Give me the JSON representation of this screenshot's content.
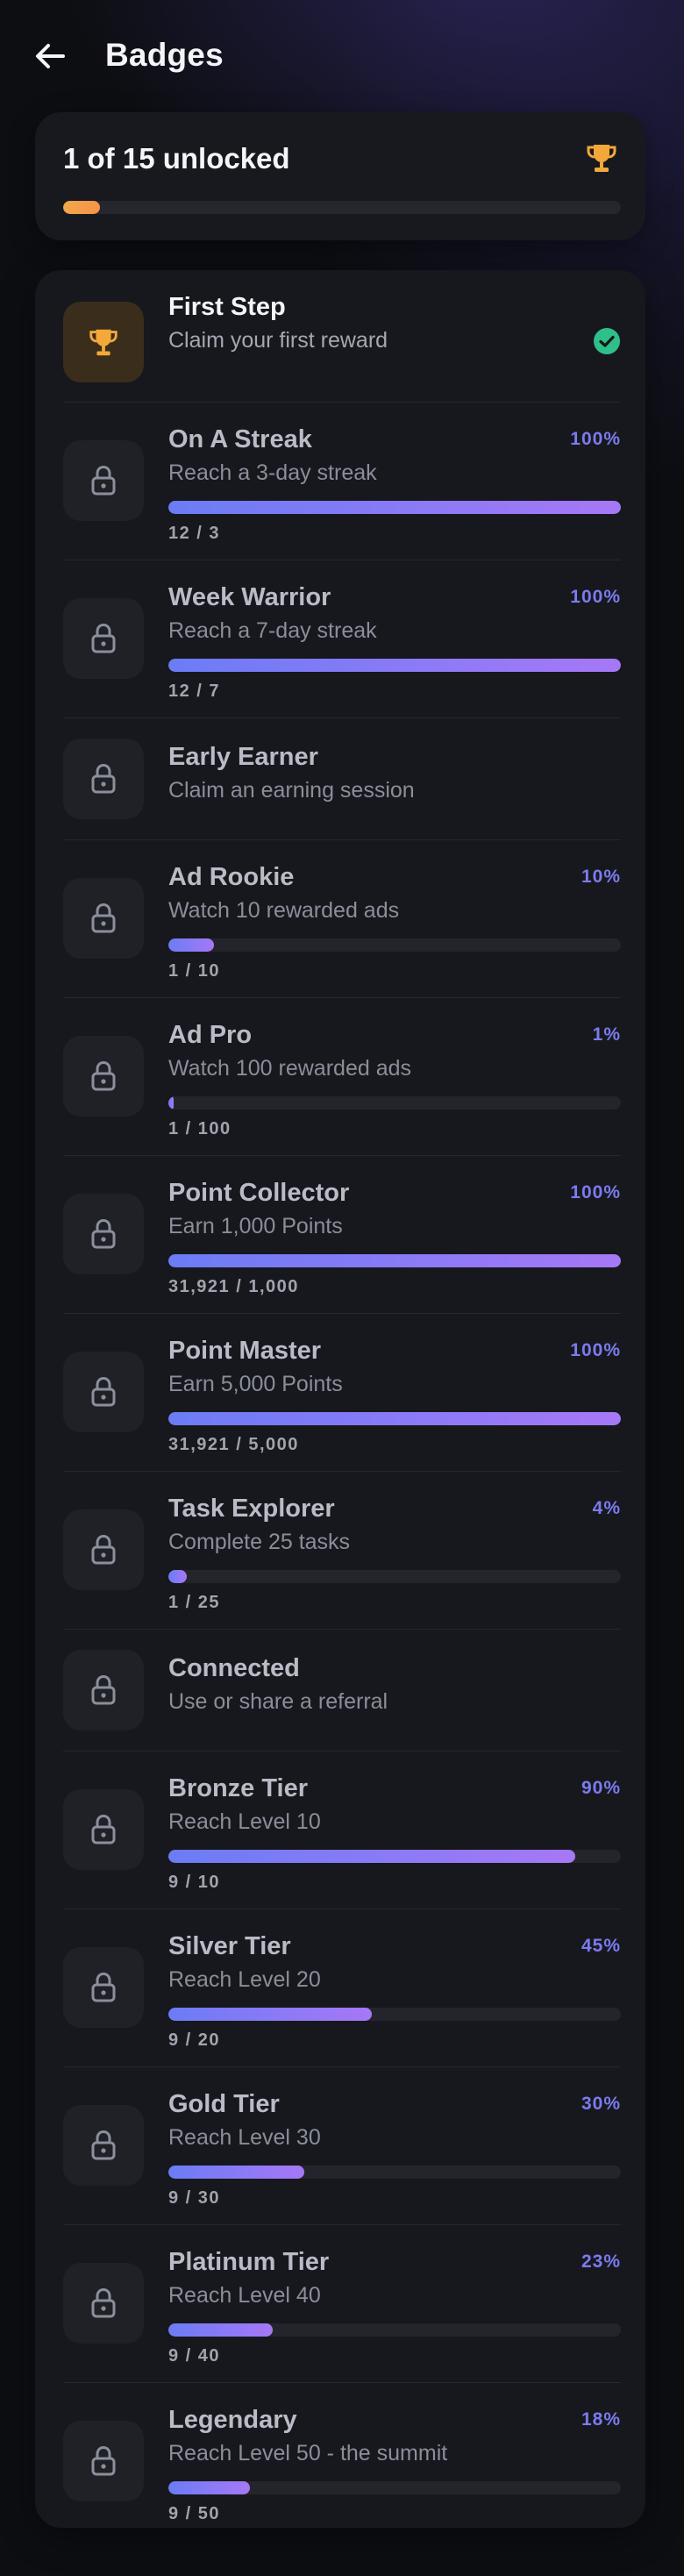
{
  "header": {
    "title": "Badges",
    "back_icon": "arrow-left-icon"
  },
  "summary": {
    "title": "1 of 15 unlocked",
    "unlocked": 1,
    "total": 15,
    "icon": "trophy-icon",
    "progress_fraction": 0.0667
  },
  "colors": {
    "background": "#0d0e12",
    "card": "#17181d",
    "accent_purple": "#7b7bf0",
    "progress_start": "#6b7cf5",
    "progress_end": "#a678f6",
    "trophy": "#f3a83a",
    "check": "#2fbf8a"
  },
  "badges": [
    {
      "title": "First Step",
      "description": "Claim your first reward",
      "status": "unlocked",
      "icon": "trophy-icon",
      "status_icon": "check-circle-icon"
    },
    {
      "title": "On A Streak",
      "description": "Reach a 3-day streak",
      "status": "locked",
      "icon": "lock-icon",
      "percent_label": "100%",
      "progress": 1.0,
      "count": "12 / 3"
    },
    {
      "title": "Week Warrior",
      "description": "Reach a 7-day streak",
      "status": "locked",
      "icon": "lock-icon",
      "percent_label": "100%",
      "progress": 1.0,
      "count": "12 / 7"
    },
    {
      "title": "Early Earner",
      "description": "Claim an earning session",
      "status": "locked",
      "icon": "lock-icon"
    },
    {
      "title": "Ad Rookie",
      "description": "Watch 10 rewarded ads",
      "status": "locked",
      "icon": "lock-icon",
      "percent_label": "10%",
      "progress": 0.1,
      "count": "1 / 10"
    },
    {
      "title": "Ad Pro",
      "description": "Watch 100 rewarded ads",
      "status": "locked",
      "icon": "lock-icon",
      "percent_label": "1%",
      "progress": 0.01,
      "count": "1 / 100"
    },
    {
      "title": "Point Collector",
      "description": "Earn 1,000 Points",
      "status": "locked",
      "icon": "lock-icon",
      "percent_label": "100%",
      "progress": 1.0,
      "count": "31,921 / 1,000"
    },
    {
      "title": "Point Master",
      "description": "Earn 5,000 Points",
      "status": "locked",
      "icon": "lock-icon",
      "percent_label": "100%",
      "progress": 1.0,
      "count": "31,921 / 5,000"
    },
    {
      "title": "Task Explorer",
      "description": "Complete 25 tasks",
      "status": "locked",
      "icon": "lock-icon",
      "percent_label": "4%",
      "progress": 0.04,
      "count": "1 / 25"
    },
    {
      "title": "Connected",
      "description": "Use or share a referral",
      "status": "locked",
      "icon": "lock-icon"
    },
    {
      "title": "Bronze Tier",
      "description": "Reach Level 10",
      "status": "locked",
      "icon": "lock-icon",
      "percent_label": "90%",
      "progress": 0.9,
      "count": "9 / 10"
    },
    {
      "title": "Silver Tier",
      "description": "Reach Level 20",
      "status": "locked",
      "icon": "lock-icon",
      "percent_label": "45%",
      "progress": 0.45,
      "count": "9 / 20"
    },
    {
      "title": "Gold Tier",
      "description": "Reach Level 30",
      "status": "locked",
      "icon": "lock-icon",
      "percent_label": "30%",
      "progress": 0.3,
      "count": "9 / 30"
    },
    {
      "title": "Platinum Tier",
      "description": "Reach Level 40",
      "status": "locked",
      "icon": "lock-icon",
      "percent_label": "23%",
      "progress": 0.23,
      "count": "9 / 40"
    },
    {
      "title": "Legendary",
      "description": "Reach Level 50 - the summit",
      "status": "locked",
      "icon": "lock-icon",
      "percent_label": "18%",
      "progress": 0.18,
      "count": "9 / 50"
    }
  ]
}
